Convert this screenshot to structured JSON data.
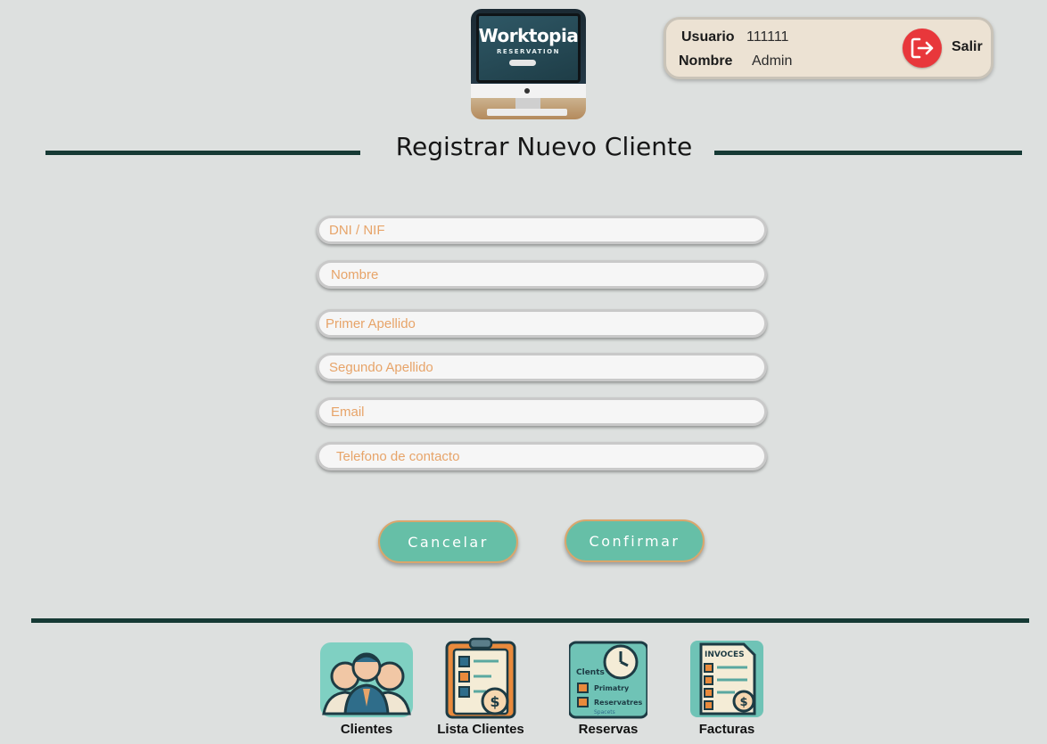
{
  "logo": {
    "word": "Worktopia",
    "sub": "RESERVATION"
  },
  "user": {
    "usuario_label": "Usuario",
    "usuario_value": "111111",
    "nombre_label": "Nombre",
    "nombre_value": "Admin",
    "logout_label": "Salir"
  },
  "page_title": "Registrar Nuevo Cliente",
  "form": {
    "dni_placeholder": "DNI / NIF",
    "nombre_placeholder": "Nombre",
    "apellido1_placeholder": "Primer Apellido",
    "apellido2_placeholder": "Segundo Apellido",
    "email_placeholder": "Email",
    "telefono_placeholder": "Telefono de contacto"
  },
  "buttons": {
    "cancel": "Cancelar",
    "confirm": "Confirmar"
  },
  "nav": {
    "clientes": "Clientes",
    "lista_clientes": "Lista Clientes",
    "reservas": "Reservas",
    "facturas": "Facturas",
    "reservas_icon_lines": [
      "Clents",
      "Primatry",
      "Reservatres",
      "Spacets"
    ],
    "facturas_icon_title": "INVOCES"
  },
  "colors": {
    "accent": "#66bfa7",
    "rule": "#163a35",
    "placeholder": "#e7a469",
    "logout": "#e8373b",
    "panel": "#ece2d3"
  }
}
